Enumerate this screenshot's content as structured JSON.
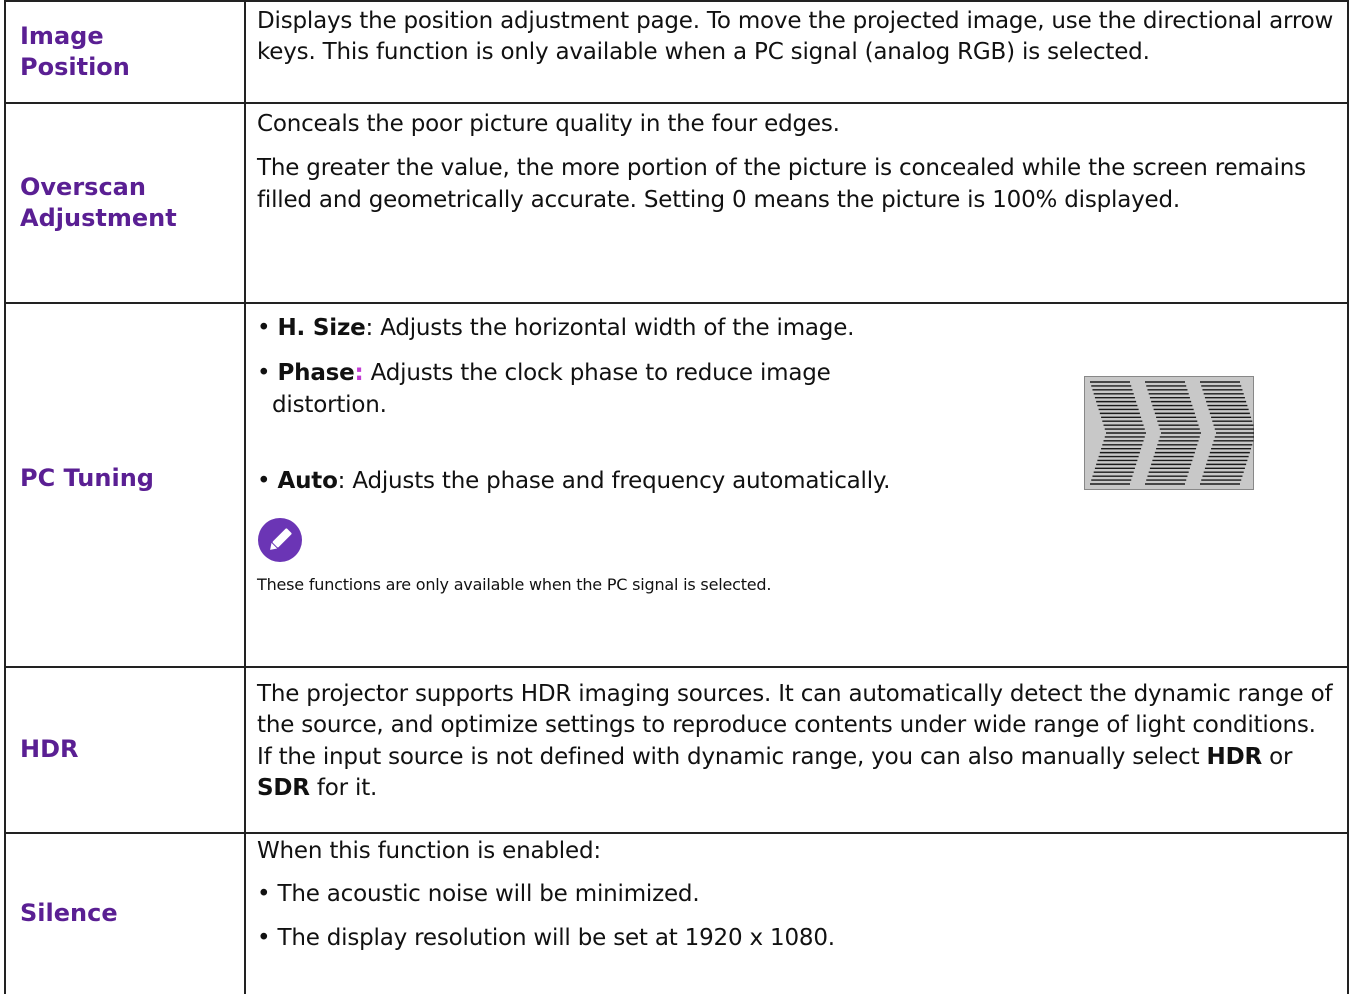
{
  "rows": [
    {
      "label": "Image Position",
      "text": "Displays the position adjustment page. To move the projected image, use the directional arrow keys. This function is only available when a PC signal (analog RGB) is selected."
    },
    {
      "label": "Overscan Adjustment",
      "p1": "Conceals the poor picture quality in the four edges.",
      "p2": "The greater the value, the more portion of the picture is concealed while the screen remains filled and geometrically accurate. Setting 0 means the picture is 100% displayed."
    },
    {
      "label": "PC Tuning",
      "bullet": "•",
      "hsize_term": "H. Size",
      "hsize_text": ": Adjusts the horizontal width of the image.",
      "phase_term": "Phase",
      "phase_colon": ":",
      "phase_text": " Adjusts the clock phase to reduce image distortion.",
      "auto_term": "Auto",
      "auto_text": ": Adjusts the phase and frequency automatically.",
      "note_icon": "pencil-icon",
      "note": "These functions are only available when the PC signal is selected.",
      "illustration_icon": "phase-distortion-pattern"
    },
    {
      "label": "HDR",
      "text_a": "The projector supports HDR imaging sources. It can automatically detect the dynamic range of the source, and optimize settings to reproduce contents under wide range of light conditions. If the input source is not defined with dynamic range, you can also manually select ",
      "hdr": "HDR",
      "or": " or ",
      "sdr": "SDR",
      "text_b": " for it."
    },
    {
      "label": "Silence",
      "intro": "When this function is enabled:",
      "item1": "• The acoustic noise will be minimized.",
      "item2": "• The display resolution will be set at 1920 x 1080."
    }
  ],
  "colors": {
    "label": "#5a1f93",
    "phase_colon": "#c23cd3",
    "icon_bg": "#6b35b5",
    "border": "#222222"
  }
}
